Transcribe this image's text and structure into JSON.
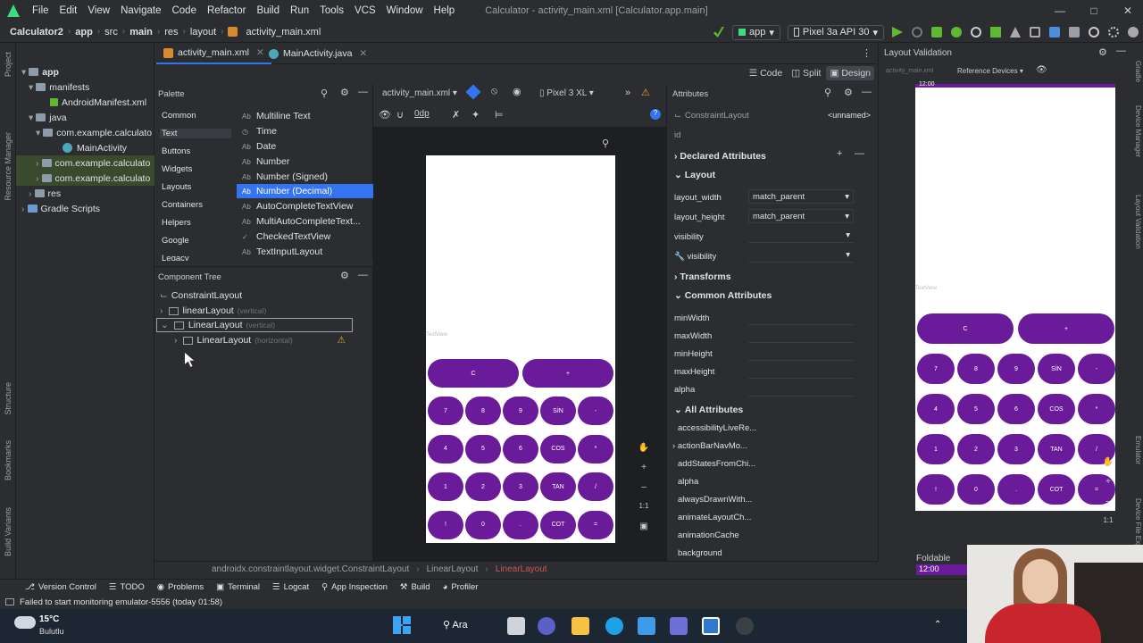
{
  "menu": {
    "items": [
      "File",
      "Edit",
      "View",
      "Navigate",
      "Code",
      "Refactor",
      "Build",
      "Run",
      "Tools",
      "VCS",
      "Window",
      "Help"
    ],
    "window_title": "Calculator - activity_main.xml [Calculator.app.main]"
  },
  "breadcrumb": [
    "Calculator2",
    "app",
    "src",
    "main",
    "res",
    "layout",
    "activity_main.xml"
  ],
  "toolbar": {
    "run_config": "app",
    "device": "Pixel 3a API 30"
  },
  "project_tree": [
    {
      "label": "app",
      "level": 0
    },
    {
      "label": "manifests",
      "level": 1
    },
    {
      "label": "AndroidManifest.xml",
      "level": 2
    },
    {
      "label": "java",
      "level": 1
    },
    {
      "label": "com.example.calculato",
      "level": 2
    },
    {
      "label": "MainActivity",
      "level": 3
    },
    {
      "label": "com.example.calculato",
      "level": 2
    },
    {
      "label": "com.example.calculato",
      "level": 2
    },
    {
      "label": "res",
      "level": 1
    },
    {
      "label": "Gradle Scripts",
      "level": 0
    }
  ],
  "tabs": [
    {
      "label": "activity_main.xml",
      "active": true
    },
    {
      "label": "MainActivity.java",
      "active": false
    }
  ],
  "modes": [
    "Code",
    "Split",
    "Design"
  ],
  "palette": {
    "title": "Palette",
    "categories": [
      "Common",
      "Text",
      "Buttons",
      "Widgets",
      "Layouts",
      "Containers",
      "Helpers",
      "Google",
      "Legacy"
    ],
    "items": [
      "Multiline Text",
      "Time",
      "Date",
      "Number",
      "Number (Signed)",
      "Number (Decimal)",
      "AutoCompleteTextView",
      "MultiAutoCompleteText...",
      "CheckedTextView",
      "TextInputLayout"
    ],
    "selected": "Number (Decimal)"
  },
  "component_tree": {
    "title": "Component Tree",
    "rows": [
      {
        "label": "ConstraintLayout",
        "hint": ""
      },
      {
        "label": "linearLayout",
        "hint": "(vertical)"
      },
      {
        "label": "LinearLayout",
        "hint": "(vertical)"
      },
      {
        "label": "LinearLayout",
        "hint": "(horizontal)"
      }
    ]
  },
  "design_toolbar": {
    "file": "activity_main.xml",
    "device": "Pixel 3 XL",
    "margin": "0dp"
  },
  "calculator": {
    "textview": "TextView",
    "top_buttons": [
      "C",
      "+"
    ],
    "rows": [
      [
        "7",
        "8",
        "9",
        "SİN",
        "-"
      ],
      [
        "4",
        "5",
        "6",
        "COS",
        "*"
      ],
      [
        "1",
        "2",
        "3",
        "TAN",
        "/"
      ],
      [
        "!",
        "0",
        ".",
        "COT",
        "="
      ]
    ]
  },
  "attributes": {
    "title": "Attributes",
    "component": "ConstraintLayout",
    "name": "<unnamed>",
    "id_label": "id",
    "sections": {
      "declared": "Declared Attributes",
      "layout": "Layout",
      "transforms": "Transforms",
      "common": "Common Attributes",
      "all": "All Attributes"
    },
    "layout_rows": [
      {
        "name": "layout_width",
        "value": "match_parent"
      },
      {
        "name": "layout_height",
        "value": "match_parent"
      },
      {
        "name": "visibility",
        "value": ""
      },
      {
        "name": "visibility",
        "value": ""
      }
    ],
    "common_rows": [
      "minWidth",
      "maxWidth",
      "minHeight",
      "maxHeight",
      "alpha"
    ],
    "all_rows": [
      "accessibilityLiveRe...",
      "actionBarNavMo...",
      "addStatesFromChi...",
      "alpha",
      "alwaysDrawnWith...",
      "animateLayoutCh...",
      "animationCache",
      "background"
    ]
  },
  "validation": {
    "title": "Layout Validation",
    "file": "activity_main.xml",
    "reference": "Reference Devices",
    "clock": "12:00",
    "foldable": "Foldable",
    "textview": "TextView"
  },
  "status_breadcrumb": [
    "androidx.constraintlayout.widget.ConstraintLayout",
    "LinearLayout",
    "LinearLayout"
  ],
  "tool_windows": [
    "Version Control",
    "TODO",
    "Problems",
    "Terminal",
    "Logcat",
    "App Inspection",
    "Build",
    "Profiler"
  ],
  "message": "Failed to start monitoring emulator-5556 (today 01:58)",
  "weather": {
    "temp": "15°C",
    "desc": "Bulutlu"
  },
  "taskbar_search": "Ara",
  "left_strip": [
    "Project",
    "Resource Manager",
    "Structure",
    "Bookmarks",
    "Build Variants"
  ],
  "right_strip": [
    "Gradle",
    "Device Manager",
    "Layout Validation",
    "Emulator",
    "Device File Explorer"
  ],
  "colors": {
    "purple": "#6a1b9a",
    "accent": "#3574f0",
    "bg": "#2b2d30"
  }
}
